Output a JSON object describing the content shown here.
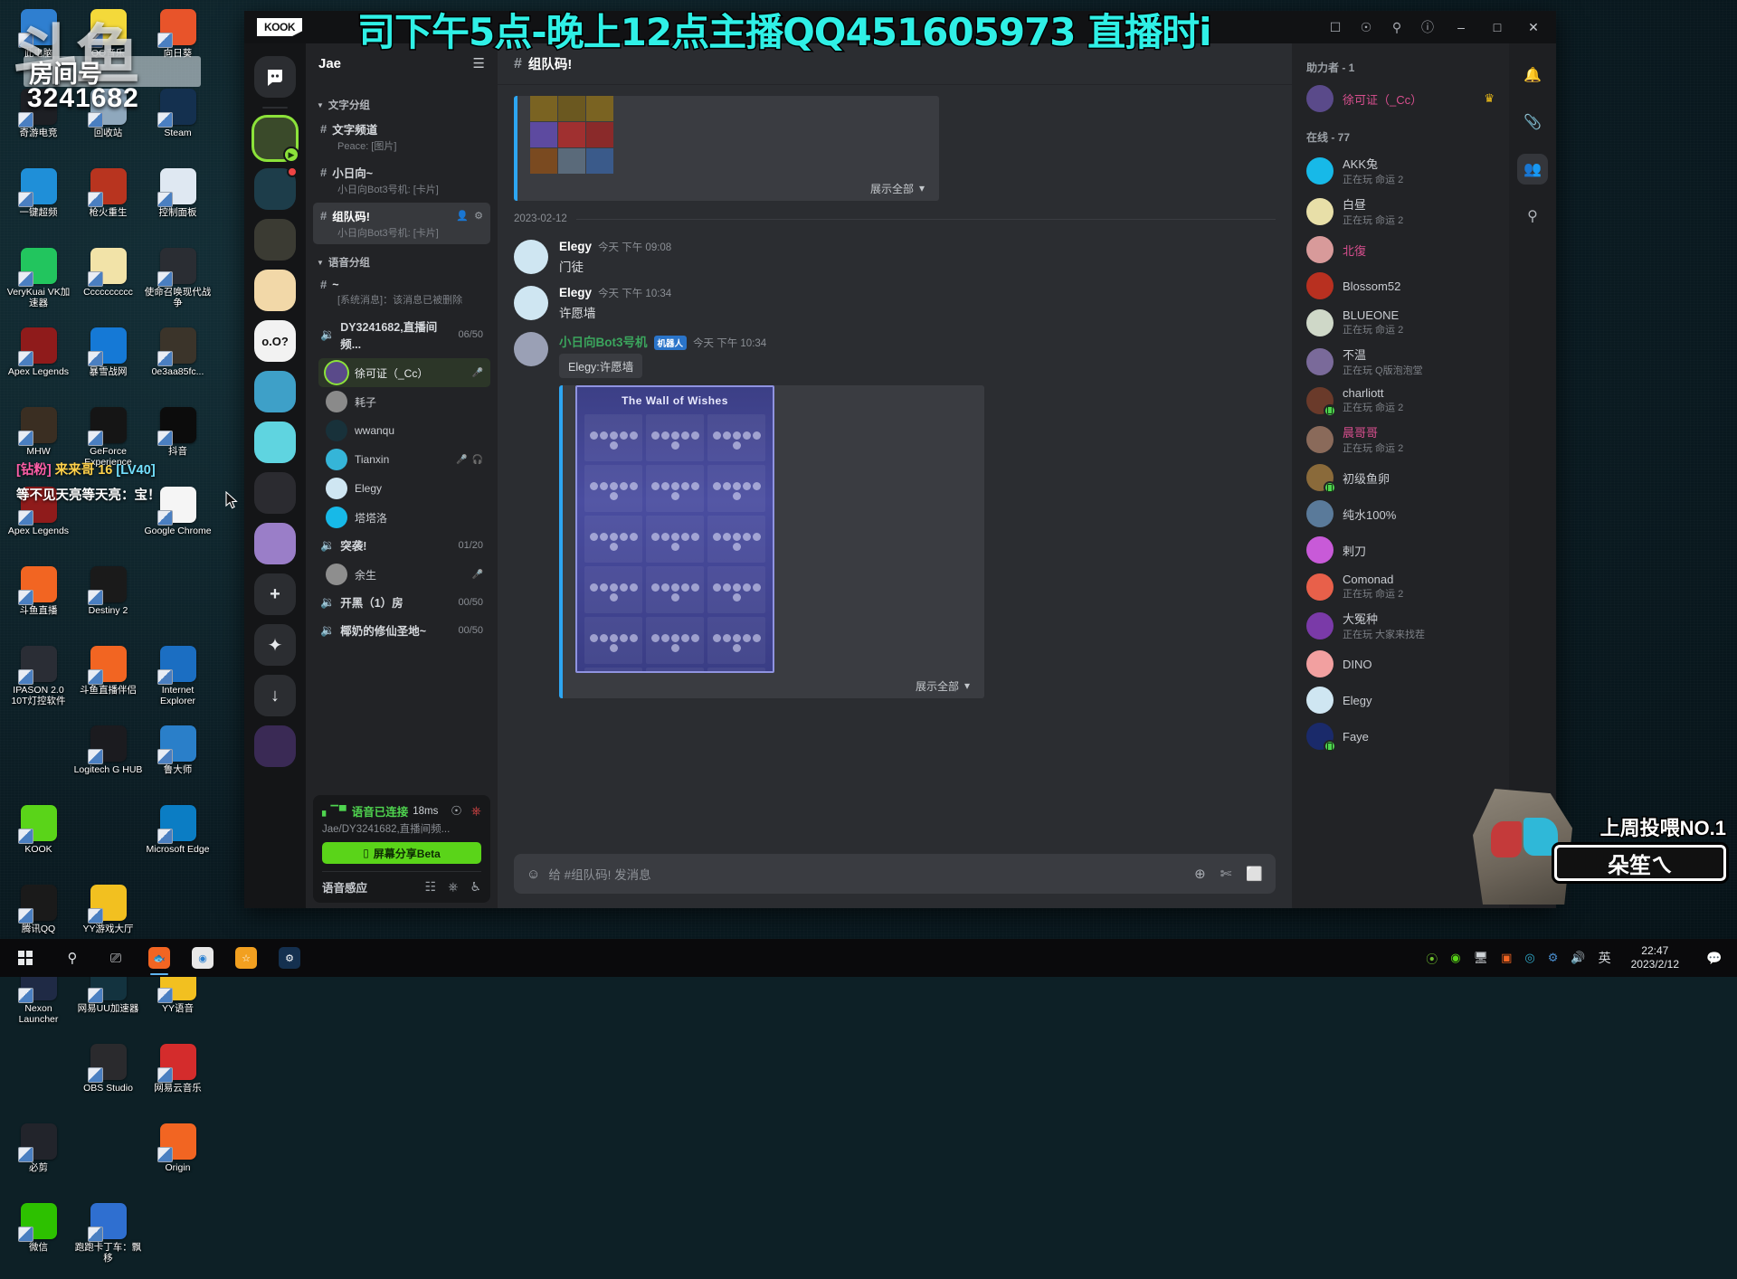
{
  "desktop": {
    "watermark": {
      "site": "斗鱼",
      "room_label": "房间号",
      "room_number": "3241682"
    },
    "danmu": {
      "tag": "[钻粉]",
      "user": "来来哥 16",
      "level": "[LV40]",
      "message": "等不见天亮等天亮：宝！"
    },
    "icons": [
      {
        "label": "此电脑",
        "icon": "computer-icon",
        "color": "#2f7fd0"
      },
      {
        "label": "QQ音乐",
        "icon": "qq-music-icon",
        "color": "#f4d93a"
      },
      {
        "label": "向日葵",
        "icon": "sunflower-remote-icon",
        "color": "#e8542a"
      },
      {
        "label": "奇游电竞",
        "icon": "qiyou-icon",
        "color": "#1d1f24"
      },
      {
        "label": "回收站",
        "icon": "recycle-bin-icon",
        "color": "#8fa8bd"
      },
      {
        "label": "Steam",
        "icon": "steam-icon",
        "color": "#14304f"
      },
      {
        "label": "一键超频",
        "icon": "overclock-icon",
        "color": "#1f8fd8"
      },
      {
        "label": "枪火重生",
        "icon": "gunfire-icon",
        "color": "#b8341f"
      },
      {
        "label": "控制面板",
        "icon": "control-panel-icon",
        "color": "#dfe8f2"
      },
      {
        "label": "VeryKuai VK加速器",
        "icon": "verykuai-icon",
        "color": "#22c55e"
      },
      {
        "label": "Cccccccccc",
        "icon": "folder-icon",
        "color": "#f2e3a8"
      },
      {
        "label": "使命召唤现代战争",
        "icon": "cod-icon",
        "color": "#2a2d33"
      },
      {
        "label": "Apex Legends",
        "icon": "apex-icon",
        "color": "#8f1b1b"
      },
      {
        "label": "暴雪战网",
        "icon": "battlenet-icon",
        "color": "#1579d6"
      },
      {
        "label": "0e3aa85fc...",
        "icon": "file-icon",
        "color": "#3b342a"
      },
      {
        "label": "MHW",
        "icon": "mhw-icon",
        "color": "#3a2e22"
      },
      {
        "label": "GeForce Experience",
        "icon": "geforce-icon",
        "color": "#151515"
      },
      {
        "label": "抖音",
        "icon": "douyin-icon",
        "color": "#0c0c0c"
      },
      {
        "label": "Apex Legends",
        "icon": "apex-icon",
        "color": "#8f1b1b"
      },
      {
        "label": "",
        "icon": "blank-icon",
        "color": "transparent"
      },
      {
        "label": "Google Chrome",
        "icon": "chrome-icon",
        "color": "#f5f5f5"
      },
      {
        "label": "斗鱼直播",
        "icon": "douyu-live-icon",
        "color": "#f26522"
      },
      {
        "label": "Destiny 2",
        "icon": "destiny2-icon",
        "color": "#1a1a1a"
      },
      {
        "label": "",
        "icon": "blank-icon",
        "color": "transparent"
      },
      {
        "label": "IPASON 2.0 10T灯控软件",
        "icon": "ipason-icon",
        "color": "#2a2d35"
      },
      {
        "label": "斗鱼直播伴侣",
        "icon": "douyu-companion-icon",
        "color": "#f26522"
      },
      {
        "label": "Internet Explorer",
        "icon": "ie-icon",
        "color": "#1b6ec2"
      },
      {
        "label": "",
        "icon": "blank-icon",
        "color": "transparent"
      },
      {
        "label": "Logitech G HUB",
        "icon": "logitech-ghub-icon",
        "color": "#1b1b1f"
      },
      {
        "label": "鲁大师",
        "icon": "ludashi-icon",
        "color": "#2a7fc9"
      },
      {
        "label": "KOOK",
        "icon": "kook-icon",
        "color": "#5ad419"
      },
      {
        "label": "",
        "icon": "blank-icon",
        "color": "transparent"
      },
      {
        "label": "Microsoft Edge",
        "icon": "edge-icon",
        "color": "#0b7dc4"
      },
      {
        "label": "腾讯QQ",
        "icon": "tencent-qq-icon",
        "color": "#1a1a1a"
      },
      {
        "label": "YY游戏大厅",
        "icon": "yy-games-icon",
        "color": "#f2c020"
      },
      {
        "label": "",
        "icon": "blank-icon",
        "color": "transparent"
      },
      {
        "label": "Nexon Launcher",
        "icon": "nexon-icon",
        "color": "#1f2a45"
      },
      {
        "label": "网易UU加速器",
        "icon": "uu-booster-icon",
        "color": "#13333f"
      },
      {
        "label": "YY语音",
        "icon": "yy-voice-icon",
        "color": "#f2c020"
      },
      {
        "label": "",
        "icon": "blank-icon",
        "color": "transparent"
      },
      {
        "label": "OBS Studio",
        "icon": "obs-icon",
        "color": "#2a2a2d"
      },
      {
        "label": "网易云音乐",
        "icon": "netease-music-icon",
        "color": "#d42c2c"
      },
      {
        "label": "必剪",
        "icon": "bijian-icon",
        "color": "#22242b"
      },
      {
        "label": "",
        "icon": "blank-icon",
        "color": "transparent"
      },
      {
        "label": "Origin",
        "icon": "origin-icon",
        "color": "#f26522"
      },
      {
        "label": "微信",
        "icon": "wechat-icon",
        "color": "#2dc100"
      },
      {
        "label": "跑跑卡丁车：飘移",
        "icon": "kartrider-icon",
        "color": "#2f6fd0"
      }
    ]
  },
  "stream_banner": "司下午5点-晚上12点主播QQ451605973 直播时i",
  "window": {
    "logo": "KOOK",
    "titlebar_icons": [
      "gift-icon",
      "megaphone-icon",
      "search-icon",
      "help-icon"
    ],
    "controls": [
      "minimize",
      "maximize",
      "close"
    ]
  },
  "rail": {
    "home_icon": "kook-home-icon",
    "guilds": [
      {
        "name": "Jae",
        "icon": "guild-jae-icon",
        "selected": true,
        "mic": true,
        "color": "#3a4a2a"
      },
      {
        "name": "guild-2",
        "icon": "guild-avatar-icon",
        "selected": false,
        "badge": true,
        "color": "#1d3d4a"
      },
      {
        "name": "guild-3",
        "icon": "guild-avatar-icon",
        "selected": false,
        "color": "#3b3b33"
      },
      {
        "name": "guild-4",
        "icon": "guild-avatar-icon",
        "selected": false,
        "color": "#f2d8a8"
      },
      {
        "name": "o.O?",
        "icon": "guild-text-icon",
        "selected": false,
        "color": "#f2f2f2",
        "label": "o.O?"
      },
      {
        "name": "guild-6",
        "icon": "guild-avatar-icon",
        "selected": false,
        "color": "#3ea0c8"
      },
      {
        "name": "guild-7",
        "icon": "guild-avatar-icon",
        "selected": false,
        "color": "#5fd4e0"
      },
      {
        "name": "guild-8",
        "icon": "guild-avatar-icon",
        "selected": false,
        "color": "#2b2b30"
      },
      {
        "name": "guild-9",
        "icon": "guild-avatar-icon",
        "selected": false,
        "color": "#9a7ec8"
      },
      {
        "name": "add",
        "icon": "plus-icon",
        "selected": false,
        "color": "#2b2d31",
        "label": "+"
      },
      {
        "name": "explore",
        "icon": "sparkle-icon",
        "selected": false,
        "color": "#2b2d31",
        "label": "✦"
      },
      {
        "name": "download",
        "icon": "download-icon",
        "selected": false,
        "color": "#2b2d31",
        "label": "↓"
      },
      {
        "name": "guild-last",
        "icon": "guild-avatar-icon",
        "selected": false,
        "color": "#3a2a55"
      }
    ]
  },
  "sidebar": {
    "server_name": "Jae",
    "menu_icon": "hamburger-icon",
    "categories": [
      {
        "name": "文字分组",
        "channels": [
          {
            "name": "文字频道",
            "sub": "Peace: [图片]",
            "active": false
          },
          {
            "name": "小日向~",
            "sub": "小日向Bot3号机: [卡片]",
            "active": false
          },
          {
            "name": "组队码!",
            "sub": "小日向Bot3号机: [卡片]",
            "active": true,
            "actions": [
              "invite-icon",
              "settings-icon"
            ]
          }
        ]
      },
      {
        "name": "语音分组",
        "channels": [
          {
            "name": "~",
            "sub": "[系统消息]：该消息已被删除",
            "active": false
          },
          {
            "name": "DY3241682,直播间频...",
            "count": "06/50",
            "voice": true,
            "members": [
              {
                "name": "徐可证（_Cc）",
                "speaking": true,
                "icons": [
                  "mic-icon"
                ],
                "color": "#5a4a8a"
              },
              {
                "name": "耗子",
                "speaking": false,
                "color": "#8a8a8a"
              },
              {
                "name": "wwanqu",
                "speaking": false,
                "color": "#18313a"
              },
              {
                "name": "Tianxin",
                "speaking": false,
                "icons": [
                  "mic-off-icon",
                  "headset-off-icon"
                ],
                "color": "#35b5d8"
              },
              {
                "name": "Elegy",
                "speaking": false,
                "color": "#cfe6f2"
              },
              {
                "name": "塔塔洛",
                "speaking": false,
                "color": "#17b9e8"
              }
            ]
          },
          {
            "name": "突袭!",
            "count": "01/20",
            "voice": true,
            "members": [
              {
                "name": "余生",
                "speaking": false,
                "icons": [
                  "mic-off-icon"
                ],
                "color": "#8e8e8e"
              }
            ]
          },
          {
            "name": "开黑（1）房",
            "count": "00/50",
            "voice": true,
            "members": []
          },
          {
            "name": "椰奶的修仙圣地~",
            "count": "00/50",
            "voice": true,
            "members": []
          }
        ]
      }
    ],
    "voice_panel": {
      "status": "语音已连接",
      "ping": "18ms",
      "signal_icon": "signal-icon",
      "location": "Jae/DY3241682,直播间频...",
      "share_label": "屏幕分享Beta",
      "share_icon": "screen-icon",
      "action_icons": [
        "noise-icon",
        "disconnect-icon"
      ],
      "sense_label": "语音感应",
      "bottom_icons": [
        "soundwave-icon",
        "mic-icon",
        "headset-icon"
      ]
    }
  },
  "main": {
    "channel_hash": "#",
    "channel_title": "组队码!",
    "embed_top": {
      "show_all": "展示全部",
      "caret_icon": "chevron-down-icon"
    },
    "day_separator": "2023-02-12",
    "messages": [
      {
        "author": "Elegy",
        "time": "今天 下午 09:08",
        "text": "门徒",
        "avatar_icon": "elegy-avatar-icon",
        "avatar_color": "#cfe6f2",
        "bot": false
      },
      {
        "author": "Elegy",
        "time": "今天 下午 10:34",
        "text": "许愿墙",
        "avatar_icon": "elegy-avatar-icon",
        "avatar_color": "#cfe6f2",
        "bot": false
      },
      {
        "author": "小日向Bot3号机",
        "bot": true,
        "bot_tag": "机器人",
        "time": "今天 下午 10:34",
        "quote": "Elegy:许愿墙",
        "avatar_icon": "bot-avatar-icon",
        "avatar_color": "#9aa0b5",
        "card": {
          "title": "The Wall of Wishes",
          "show_all": "展示全部",
          "caret_icon": "chevron-down-icon"
        }
      }
    ],
    "composer": {
      "emoji_icon": "emoji-icon",
      "placeholder": "给 #组队码! 发消息",
      "right_icons": [
        "add-icon",
        "scissors-icon",
        "expand-icon"
      ]
    }
  },
  "members": {
    "booster_head": "助力者 - 1",
    "online_head": "在线 - 77",
    "boosters": [
      {
        "name": "徐可证（_Cc）",
        "color": "#5a4a8a",
        "name_color": "#d94f8f",
        "crown": true,
        "crown_icon": "crown-icon"
      }
    ],
    "list": [
      {
        "name": "AKK兔",
        "sub": "正在玩 命运 2",
        "color": "#17b9e8"
      },
      {
        "name": "白昼",
        "sub": "正在玩 命运 2",
        "color": "#e8dfa8"
      },
      {
        "name": "北復",
        "sub": "",
        "color": "#d89a9a",
        "name_color": "#d94f8f"
      },
      {
        "name": "Blossom52",
        "sub": "",
        "color": "#b83020"
      },
      {
        "name": "BLUEONE",
        "sub": "正在玩 命运 2",
        "color": "#cfd8c8"
      },
      {
        "name": "不温",
        "sub": "正在玩 Q版泡泡堂",
        "color": "#7a6a9a"
      },
      {
        "name": "charliott",
        "sub": "正在玩 命运 2",
        "color": "#6a3a2a",
        "mobile": true
      },
      {
        "name": "晨哥哥",
        "sub": "正在玩 命运 2",
        "color": "#8a6a5a",
        "name_color": "#d94f8f"
      },
      {
        "name": "初级鱼卵",
        "sub": "",
        "color": "#8a6a3a",
        "mobile": true
      },
      {
        "name": "纯水100%",
        "sub": "",
        "color": "#5a7a9a"
      },
      {
        "name": "剌刀",
        "sub": "",
        "color": "#c85ad8"
      },
      {
        "name": "Comonad",
        "sub": "正在玩 命运 2",
        "color": "#e8604a"
      },
      {
        "name": "大冤种",
        "sub": "正在玩 大家来找茬",
        "color": "#7a3aa8"
      },
      {
        "name": "DINO",
        "sub": "",
        "color": "#f2a0a0"
      },
      {
        "name": "Elegy",
        "sub": "",
        "color": "#cfe6f2"
      },
      {
        "name": "Faye",
        "sub": "",
        "color": "#1a2a6a",
        "mobile": true
      }
    ]
  },
  "right_rail": {
    "items": [
      {
        "name": "notifications",
        "icon": "bell-icon",
        "active": false
      },
      {
        "name": "pins",
        "icon": "pin-icon",
        "active": false
      },
      {
        "name": "members",
        "icon": "people-icon",
        "active": true
      },
      {
        "name": "search",
        "icon": "search-icon",
        "active": false
      }
    ]
  },
  "overlay_character": {
    "line1": "上周投喂NO.1",
    "line2": "朵笙ㄟ"
  },
  "taskbar": {
    "start_icon": "windows-icon",
    "items": [
      {
        "name": "search",
        "icon": "search-icon"
      },
      {
        "name": "task-view",
        "icon": "task-view-icon"
      },
      {
        "name": "douyu",
        "icon": "douyu-icon",
        "running": true,
        "color": "#f26522"
      },
      {
        "name": "chrome",
        "icon": "chrome-icon",
        "running": false,
        "color": "#e8e8e8"
      },
      {
        "name": "ludashi",
        "icon": "ludashi-icon",
        "running": false,
        "color": "#f2a020"
      },
      {
        "name": "steam",
        "icon": "steam-icon",
        "running": false,
        "color": "#14304f"
      }
    ],
    "tray": [
      "nvidia-icon",
      "kook-tray-icon",
      "network-icon",
      "obs-icon",
      "uu-icon",
      "steam-tray-icon",
      "volume-icon"
    ],
    "ime": "英",
    "time": "22:47",
    "date": "2023/2/12",
    "action_center_icon": "action-center-icon"
  }
}
